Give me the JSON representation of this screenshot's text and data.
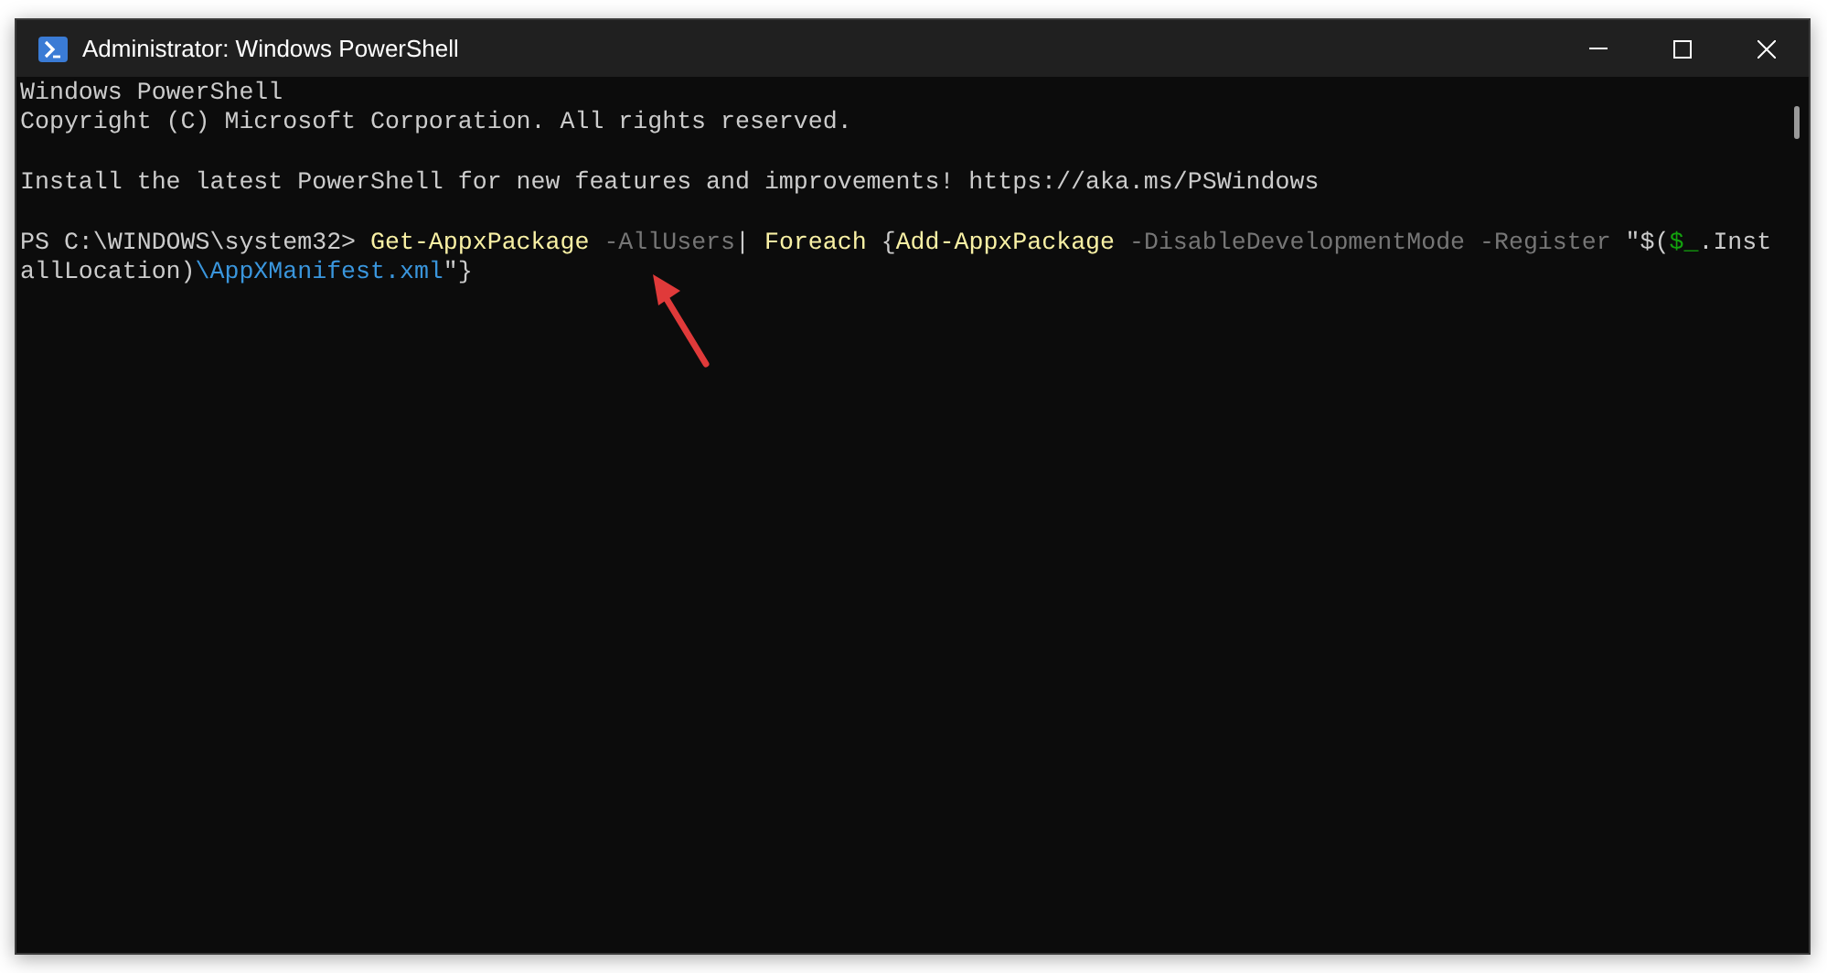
{
  "window": {
    "title": "Administrator: Windows PowerShell"
  },
  "console": {
    "lines": [
      {
        "kind": "text",
        "segments": [
          {
            "kind": "output",
            "text": "Windows PowerShell"
          }
        ]
      },
      {
        "kind": "text",
        "segments": [
          {
            "kind": "output",
            "text": "Copyright (C) Microsoft Corporation. All rights reserved."
          }
        ]
      },
      {
        "kind": "blank"
      },
      {
        "kind": "text",
        "segments": [
          {
            "kind": "output",
            "text": "Install the latest PowerShell for new features and improvements! https://aka.ms/PSWindows"
          }
        ]
      },
      {
        "kind": "blank"
      },
      {
        "kind": "text",
        "segments": [
          {
            "kind": "output",
            "text": "PS C:\\WINDOWS\\system32> "
          },
          {
            "kind": "command",
            "text": "Get-AppxPackage"
          },
          {
            "kind": "parameter",
            "text": " -AllUsers"
          },
          {
            "kind": "output",
            "text": "| "
          },
          {
            "kind": "command",
            "text": "Foreach"
          },
          {
            "kind": "output",
            "text": " {"
          },
          {
            "kind": "command",
            "text": "Add-AppxPackage"
          },
          {
            "kind": "parameter",
            "text": " -DisableDevelopmentMode -Register"
          },
          {
            "kind": "output",
            "text": " \"$("
          },
          {
            "kind": "variable",
            "text": "$_"
          },
          {
            "kind": "output",
            "text": ".Inst"
          }
        ]
      },
      {
        "kind": "text",
        "segments": [
          {
            "kind": "output",
            "text": "allLocation)"
          },
          {
            "kind": "string",
            "text": "\\AppXManifest.xml"
          },
          {
            "kind": "output",
            "text": "\"}"
          }
        ]
      }
    ]
  }
}
